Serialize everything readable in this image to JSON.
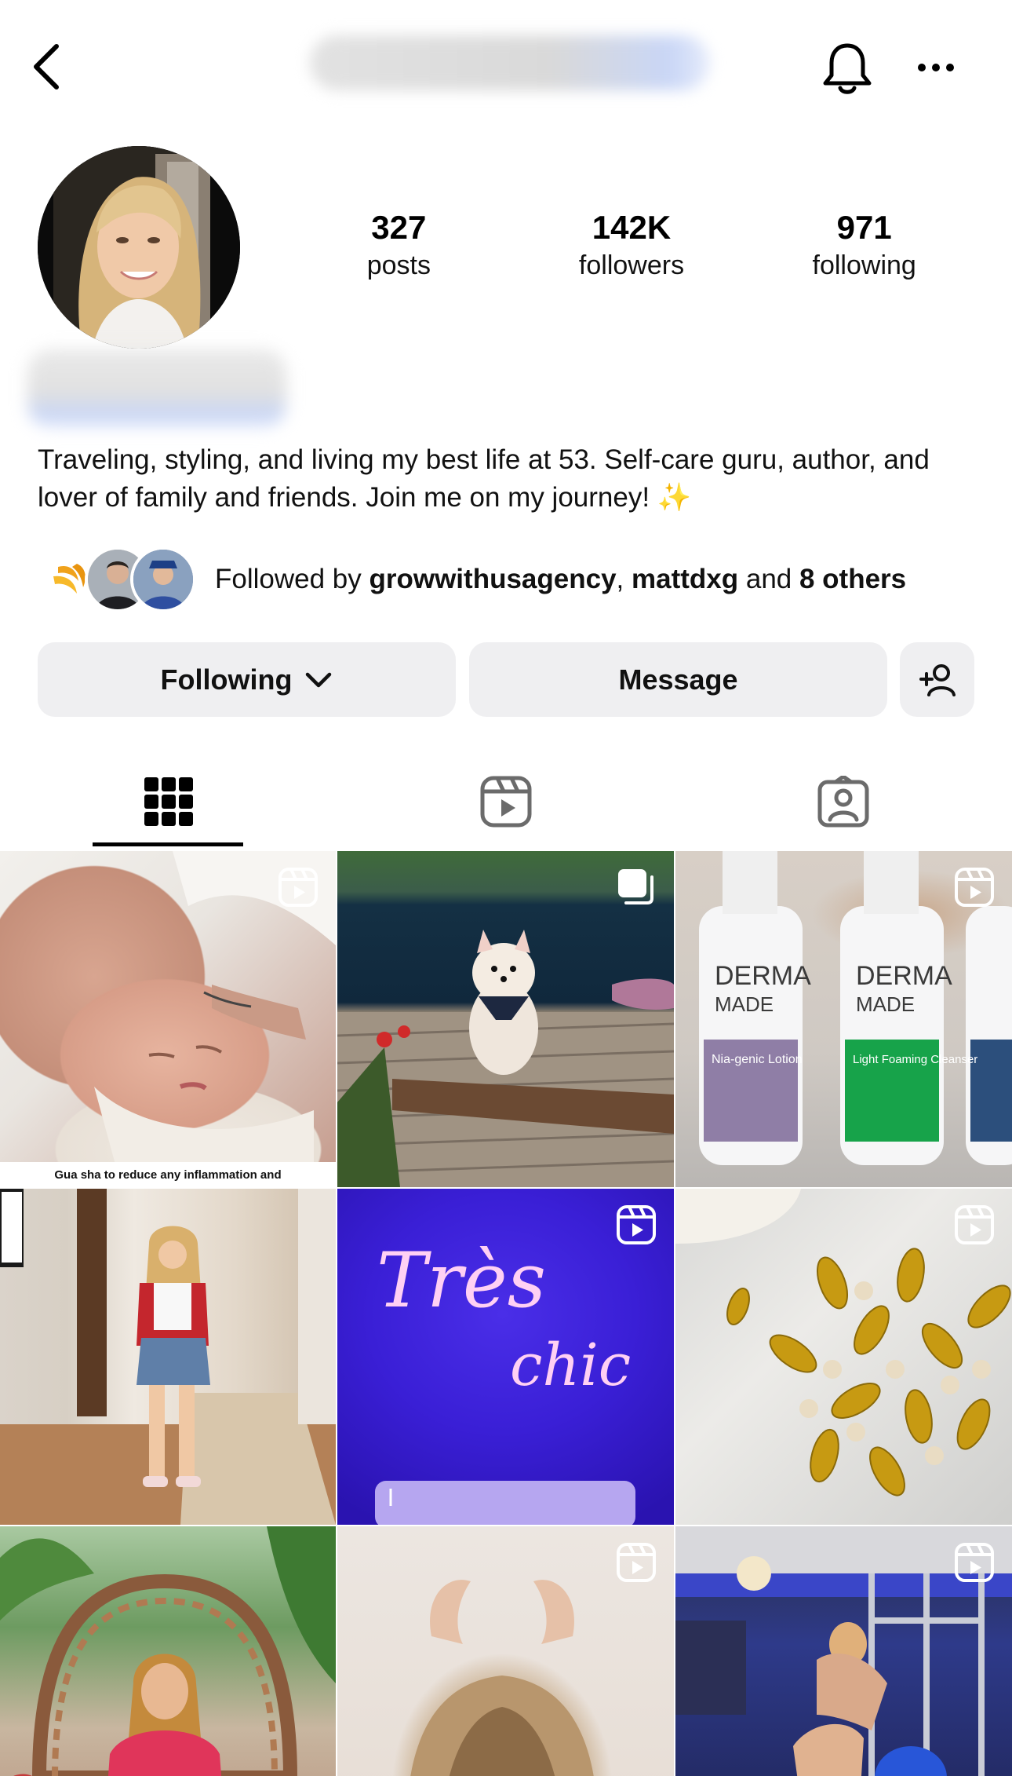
{
  "header": {
    "back_icon": "chevron-left-icon",
    "bell_icon": "bell-icon",
    "more_icon": "more-horizontal-icon"
  },
  "profile": {
    "stats": [
      {
        "value": "327",
        "label": "posts"
      },
      {
        "value": "142K",
        "label": "followers"
      },
      {
        "value": "971",
        "label": "following"
      }
    ],
    "bio": "Traveling, styling, and living my best life at 53. Self-care guru, author, and lover of family and friends. Join me on my journey! ✨"
  },
  "followed_by": {
    "prefix": "Followed by ",
    "user1": "growwithusagency",
    "separator": ", ",
    "user2": "mattdxg",
    "and": " and ",
    "others": "8 others"
  },
  "actions": {
    "following_label": "Following",
    "message_label": "Message",
    "add_user_icon": "person-add-icon"
  },
  "tabs": [
    {
      "name": "grid",
      "icon": "grid-icon",
      "active": true
    },
    {
      "name": "reels",
      "icon": "reels-icon",
      "active": false
    },
    {
      "name": "tagged",
      "icon": "tagged-person-icon",
      "active": false
    }
  ],
  "posts": [
    {
      "badge": "reel",
      "caption": "Gua sha to reduce any inflammation and"
    },
    {
      "badge": "carousel",
      "caption": ""
    },
    {
      "badge": "reel",
      "product_text": [
        "DERMA",
        "MADE",
        "Nia-genic Lotion",
        "Light Foaming Cleanser"
      ]
    },
    {
      "badge": "none"
    },
    {
      "badge": "reel",
      "neon_text_1": "Très",
      "neon_text_2": "chic"
    },
    {
      "badge": "reel"
    },
    {
      "badge": "none"
    },
    {
      "badge": "reel"
    },
    {
      "badge": "reel"
    }
  ],
  "colors": {
    "button_bg": "#efeff1",
    "text": "#000000",
    "neon_pink": "#ffd0f4"
  }
}
